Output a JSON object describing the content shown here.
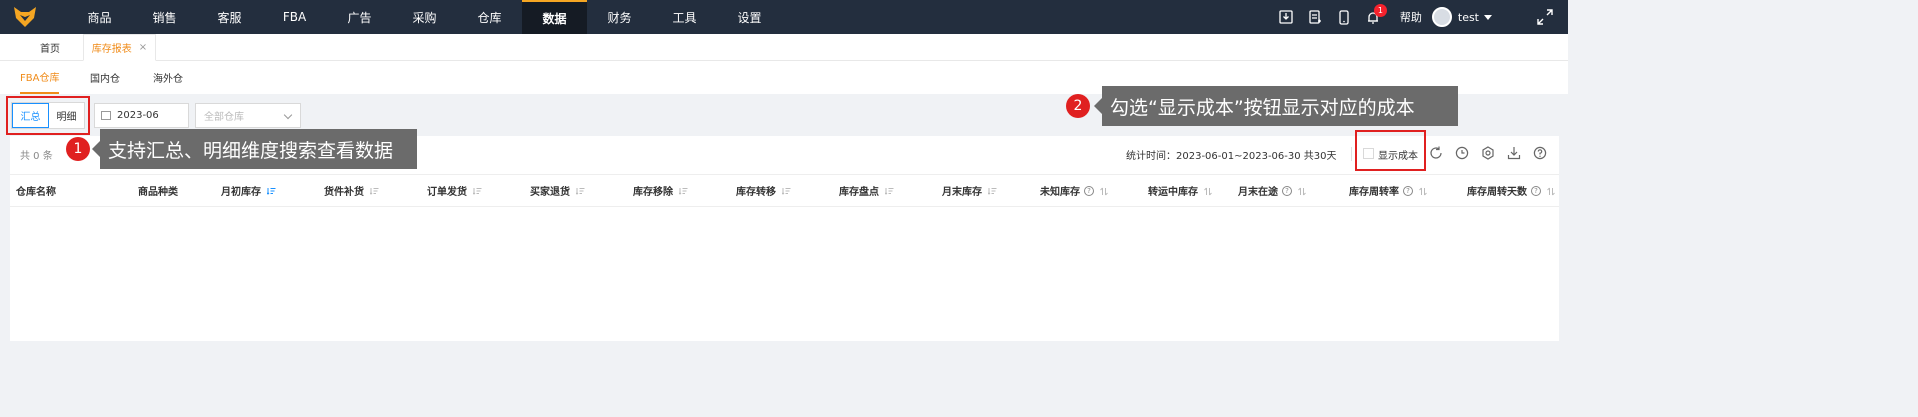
{
  "nav": {
    "items": [
      "商品",
      "销售",
      "客服",
      "FBA",
      "广告",
      "采购",
      "仓库",
      "数据",
      "财务",
      "工具",
      "设置"
    ],
    "active_index": 7,
    "notification_count": "1",
    "help_label": "帮助",
    "user_name": "test"
  },
  "tabs": {
    "home": "首页",
    "active": "库存报表",
    "close": "×"
  },
  "subtabs": [
    "FBA仓库",
    "国内仓",
    "海外仓"
  ],
  "filters": {
    "segment": [
      "汇总",
      "明细"
    ],
    "date_value": "2023-06",
    "warehouse_placeholder": "全部仓库"
  },
  "panel": {
    "total_label": "共 0 条",
    "stat_label": "统计时间：2023-06-01~2023-06-30 共30天",
    "show_cost_label": "显示成本"
  },
  "table": {
    "columns": [
      {
        "label": "仓库名称",
        "icon": "none"
      },
      {
        "label": "商品种类",
        "icon": "none"
      },
      {
        "label": "月初库存",
        "icon": "sort-active"
      },
      {
        "label": "货件补货",
        "icon": "sort"
      },
      {
        "label": "订单发货",
        "icon": "sort"
      },
      {
        "label": "买家退货",
        "icon": "sort"
      },
      {
        "label": "库存移除",
        "icon": "sort"
      },
      {
        "label": "库存转移",
        "icon": "sort"
      },
      {
        "label": "库存盘点",
        "icon": "sort"
      },
      {
        "label": "月末库存",
        "icon": "sort"
      },
      {
        "label": "未知库存",
        "icon": "help-sort"
      },
      {
        "label": "转运中库存",
        "icon": "sort-arrows"
      },
      {
        "label": "月末在途",
        "icon": "help-sort"
      },
      {
        "label": "库存周转率",
        "icon": "help-sort"
      },
      {
        "label": "库存周转天数",
        "icon": "help-sort"
      }
    ],
    "rows": []
  },
  "callouts": {
    "one_num": "1",
    "one_text": "支持汇总、明细维度搜索查看数据",
    "two_num": "2",
    "two_text": "勾选“显示成本”按钮显示对应的成本"
  },
  "colors": {
    "nav_bg": "#232e3e",
    "accent": "#f08c1a",
    "primary": "#1890ff",
    "annotation_red": "#e02020",
    "callout_bg": "#6b6b6b"
  }
}
